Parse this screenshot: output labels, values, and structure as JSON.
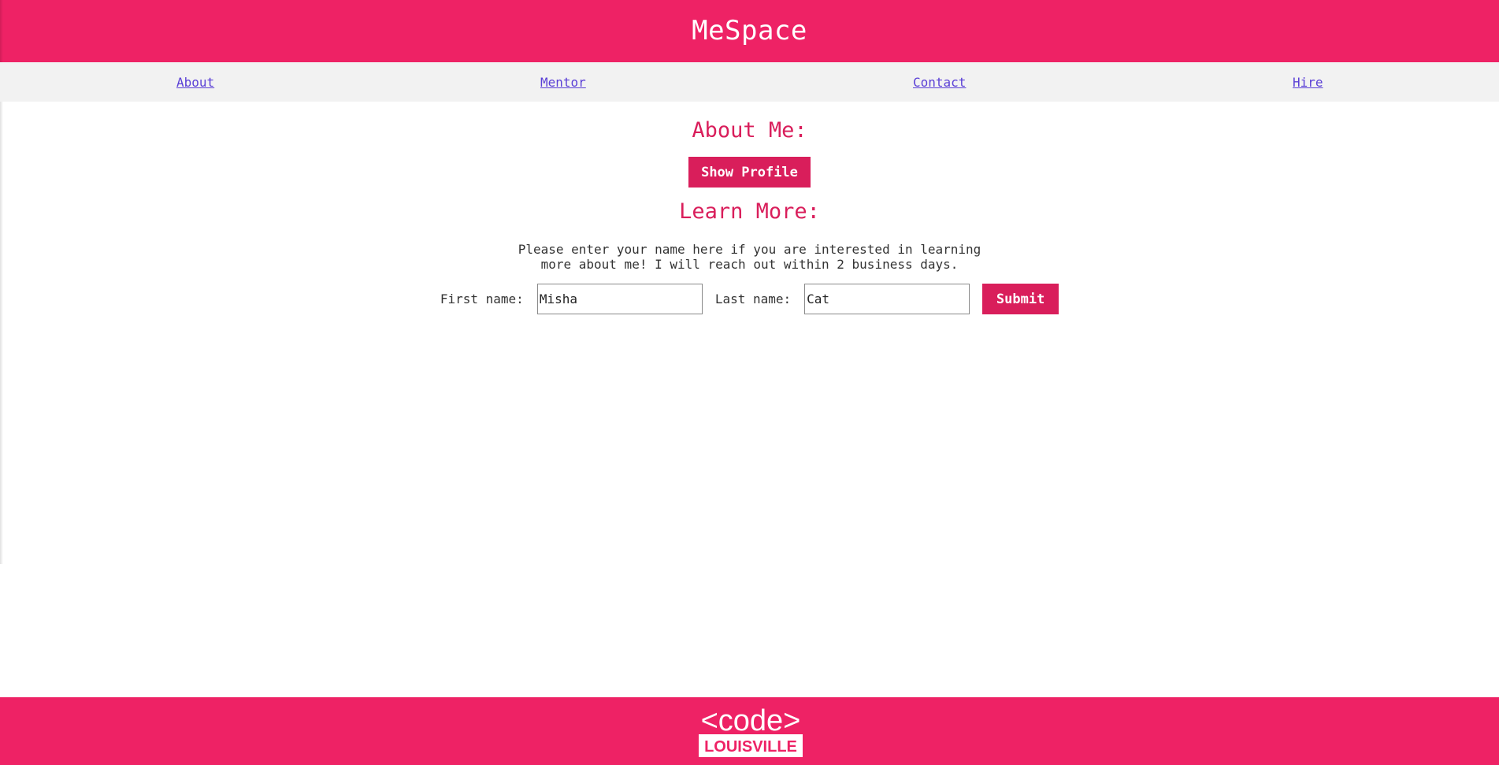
{
  "header": {
    "title": "MeSpace"
  },
  "nav": {
    "items": [
      {
        "label": "About"
      },
      {
        "label": "Mentor"
      },
      {
        "label": "Contact"
      },
      {
        "label": "Hire"
      }
    ]
  },
  "about": {
    "heading": "About Me:",
    "show_profile_label": "Show Profile"
  },
  "learn": {
    "heading": "Learn More:",
    "blurb": "Please enter your name here if you are interested in learning more about me! I will reach out within 2 business days.",
    "first_name_label": "First name:",
    "first_name_value": "Misha",
    "last_name_label": "Last name:",
    "last_name_value": "Cat",
    "submit_label": "Submit"
  },
  "footer": {
    "logo_top": "<code>",
    "logo_bottom": "LOUISVILLE"
  },
  "colors": {
    "brand": "#ee2265",
    "accent": "#d91e5b",
    "nav_bg": "#f2f2f2",
    "link": "#5a3fd6"
  }
}
